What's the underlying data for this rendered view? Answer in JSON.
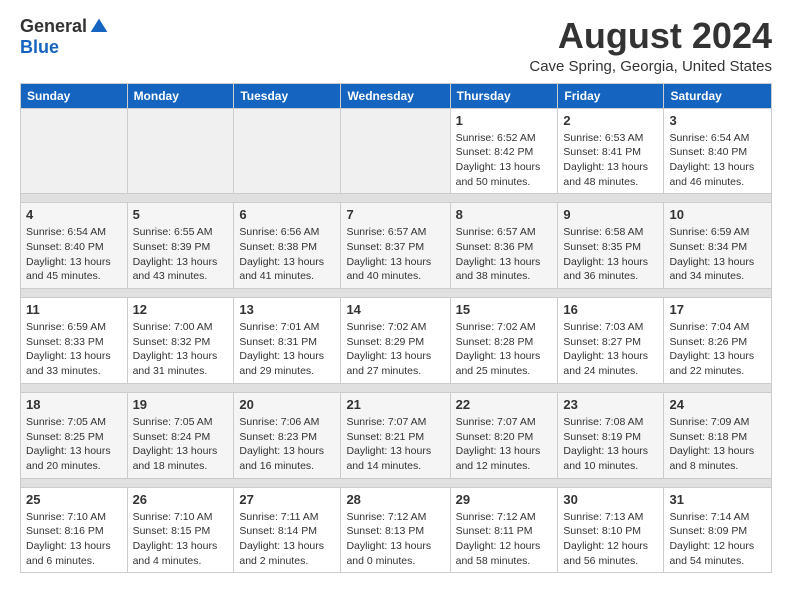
{
  "header": {
    "logo_general": "General",
    "logo_blue": "Blue",
    "month_title": "August 2024",
    "location": "Cave Spring, Georgia, United States"
  },
  "days_of_week": [
    "Sunday",
    "Monday",
    "Tuesday",
    "Wednesday",
    "Thursday",
    "Friday",
    "Saturday"
  ],
  "weeks": [
    [
      {
        "day": "",
        "empty": true
      },
      {
        "day": "",
        "empty": true
      },
      {
        "day": "",
        "empty": true
      },
      {
        "day": "",
        "empty": true
      },
      {
        "day": "1",
        "sunrise": "6:52 AM",
        "sunset": "8:42 PM",
        "daylight": "13 hours and 50 minutes."
      },
      {
        "day": "2",
        "sunrise": "6:53 AM",
        "sunset": "8:41 PM",
        "daylight": "13 hours and 48 minutes."
      },
      {
        "day": "3",
        "sunrise": "6:54 AM",
        "sunset": "8:40 PM",
        "daylight": "13 hours and 46 minutes."
      }
    ],
    [
      {
        "day": "4",
        "sunrise": "6:54 AM",
        "sunset": "8:40 PM",
        "daylight": "13 hours and 45 minutes."
      },
      {
        "day": "5",
        "sunrise": "6:55 AM",
        "sunset": "8:39 PM",
        "daylight": "13 hours and 43 minutes."
      },
      {
        "day": "6",
        "sunrise": "6:56 AM",
        "sunset": "8:38 PM",
        "daylight": "13 hours and 41 minutes."
      },
      {
        "day": "7",
        "sunrise": "6:57 AM",
        "sunset": "8:37 PM",
        "daylight": "13 hours and 40 minutes."
      },
      {
        "day": "8",
        "sunrise": "6:57 AM",
        "sunset": "8:36 PM",
        "daylight": "13 hours and 38 minutes."
      },
      {
        "day": "9",
        "sunrise": "6:58 AM",
        "sunset": "8:35 PM",
        "daylight": "13 hours and 36 minutes."
      },
      {
        "day": "10",
        "sunrise": "6:59 AM",
        "sunset": "8:34 PM",
        "daylight": "13 hours and 34 minutes."
      }
    ],
    [
      {
        "day": "11",
        "sunrise": "6:59 AM",
        "sunset": "8:33 PM",
        "daylight": "13 hours and 33 minutes."
      },
      {
        "day": "12",
        "sunrise": "7:00 AM",
        "sunset": "8:32 PM",
        "daylight": "13 hours and 31 minutes."
      },
      {
        "day": "13",
        "sunrise": "7:01 AM",
        "sunset": "8:31 PM",
        "daylight": "13 hours and 29 minutes."
      },
      {
        "day": "14",
        "sunrise": "7:02 AM",
        "sunset": "8:29 PM",
        "daylight": "13 hours and 27 minutes."
      },
      {
        "day": "15",
        "sunrise": "7:02 AM",
        "sunset": "8:28 PM",
        "daylight": "13 hours and 25 minutes."
      },
      {
        "day": "16",
        "sunrise": "7:03 AM",
        "sunset": "8:27 PM",
        "daylight": "13 hours and 24 minutes."
      },
      {
        "day": "17",
        "sunrise": "7:04 AM",
        "sunset": "8:26 PM",
        "daylight": "13 hours and 22 minutes."
      }
    ],
    [
      {
        "day": "18",
        "sunrise": "7:05 AM",
        "sunset": "8:25 PM",
        "daylight": "13 hours and 20 minutes."
      },
      {
        "day": "19",
        "sunrise": "7:05 AM",
        "sunset": "8:24 PM",
        "daylight": "13 hours and 18 minutes."
      },
      {
        "day": "20",
        "sunrise": "7:06 AM",
        "sunset": "8:23 PM",
        "daylight": "13 hours and 16 minutes."
      },
      {
        "day": "21",
        "sunrise": "7:07 AM",
        "sunset": "8:21 PM",
        "daylight": "13 hours and 14 minutes."
      },
      {
        "day": "22",
        "sunrise": "7:07 AM",
        "sunset": "8:20 PM",
        "daylight": "13 hours and 12 minutes."
      },
      {
        "day": "23",
        "sunrise": "7:08 AM",
        "sunset": "8:19 PM",
        "daylight": "13 hours and 10 minutes."
      },
      {
        "day": "24",
        "sunrise": "7:09 AM",
        "sunset": "8:18 PM",
        "daylight": "13 hours and 8 minutes."
      }
    ],
    [
      {
        "day": "25",
        "sunrise": "7:10 AM",
        "sunset": "8:16 PM",
        "daylight": "13 hours and 6 minutes."
      },
      {
        "day": "26",
        "sunrise": "7:10 AM",
        "sunset": "8:15 PM",
        "daylight": "13 hours and 4 minutes."
      },
      {
        "day": "27",
        "sunrise": "7:11 AM",
        "sunset": "8:14 PM",
        "daylight": "13 hours and 2 minutes."
      },
      {
        "day": "28",
        "sunrise": "7:12 AM",
        "sunset": "8:13 PM",
        "daylight": "13 hours and 0 minutes."
      },
      {
        "day": "29",
        "sunrise": "7:12 AM",
        "sunset": "8:11 PM",
        "daylight": "12 hours and 58 minutes."
      },
      {
        "day": "30",
        "sunrise": "7:13 AM",
        "sunset": "8:10 PM",
        "daylight": "12 hours and 56 minutes."
      },
      {
        "day": "31",
        "sunrise": "7:14 AM",
        "sunset": "8:09 PM",
        "daylight": "12 hours and 54 minutes."
      }
    ]
  ]
}
